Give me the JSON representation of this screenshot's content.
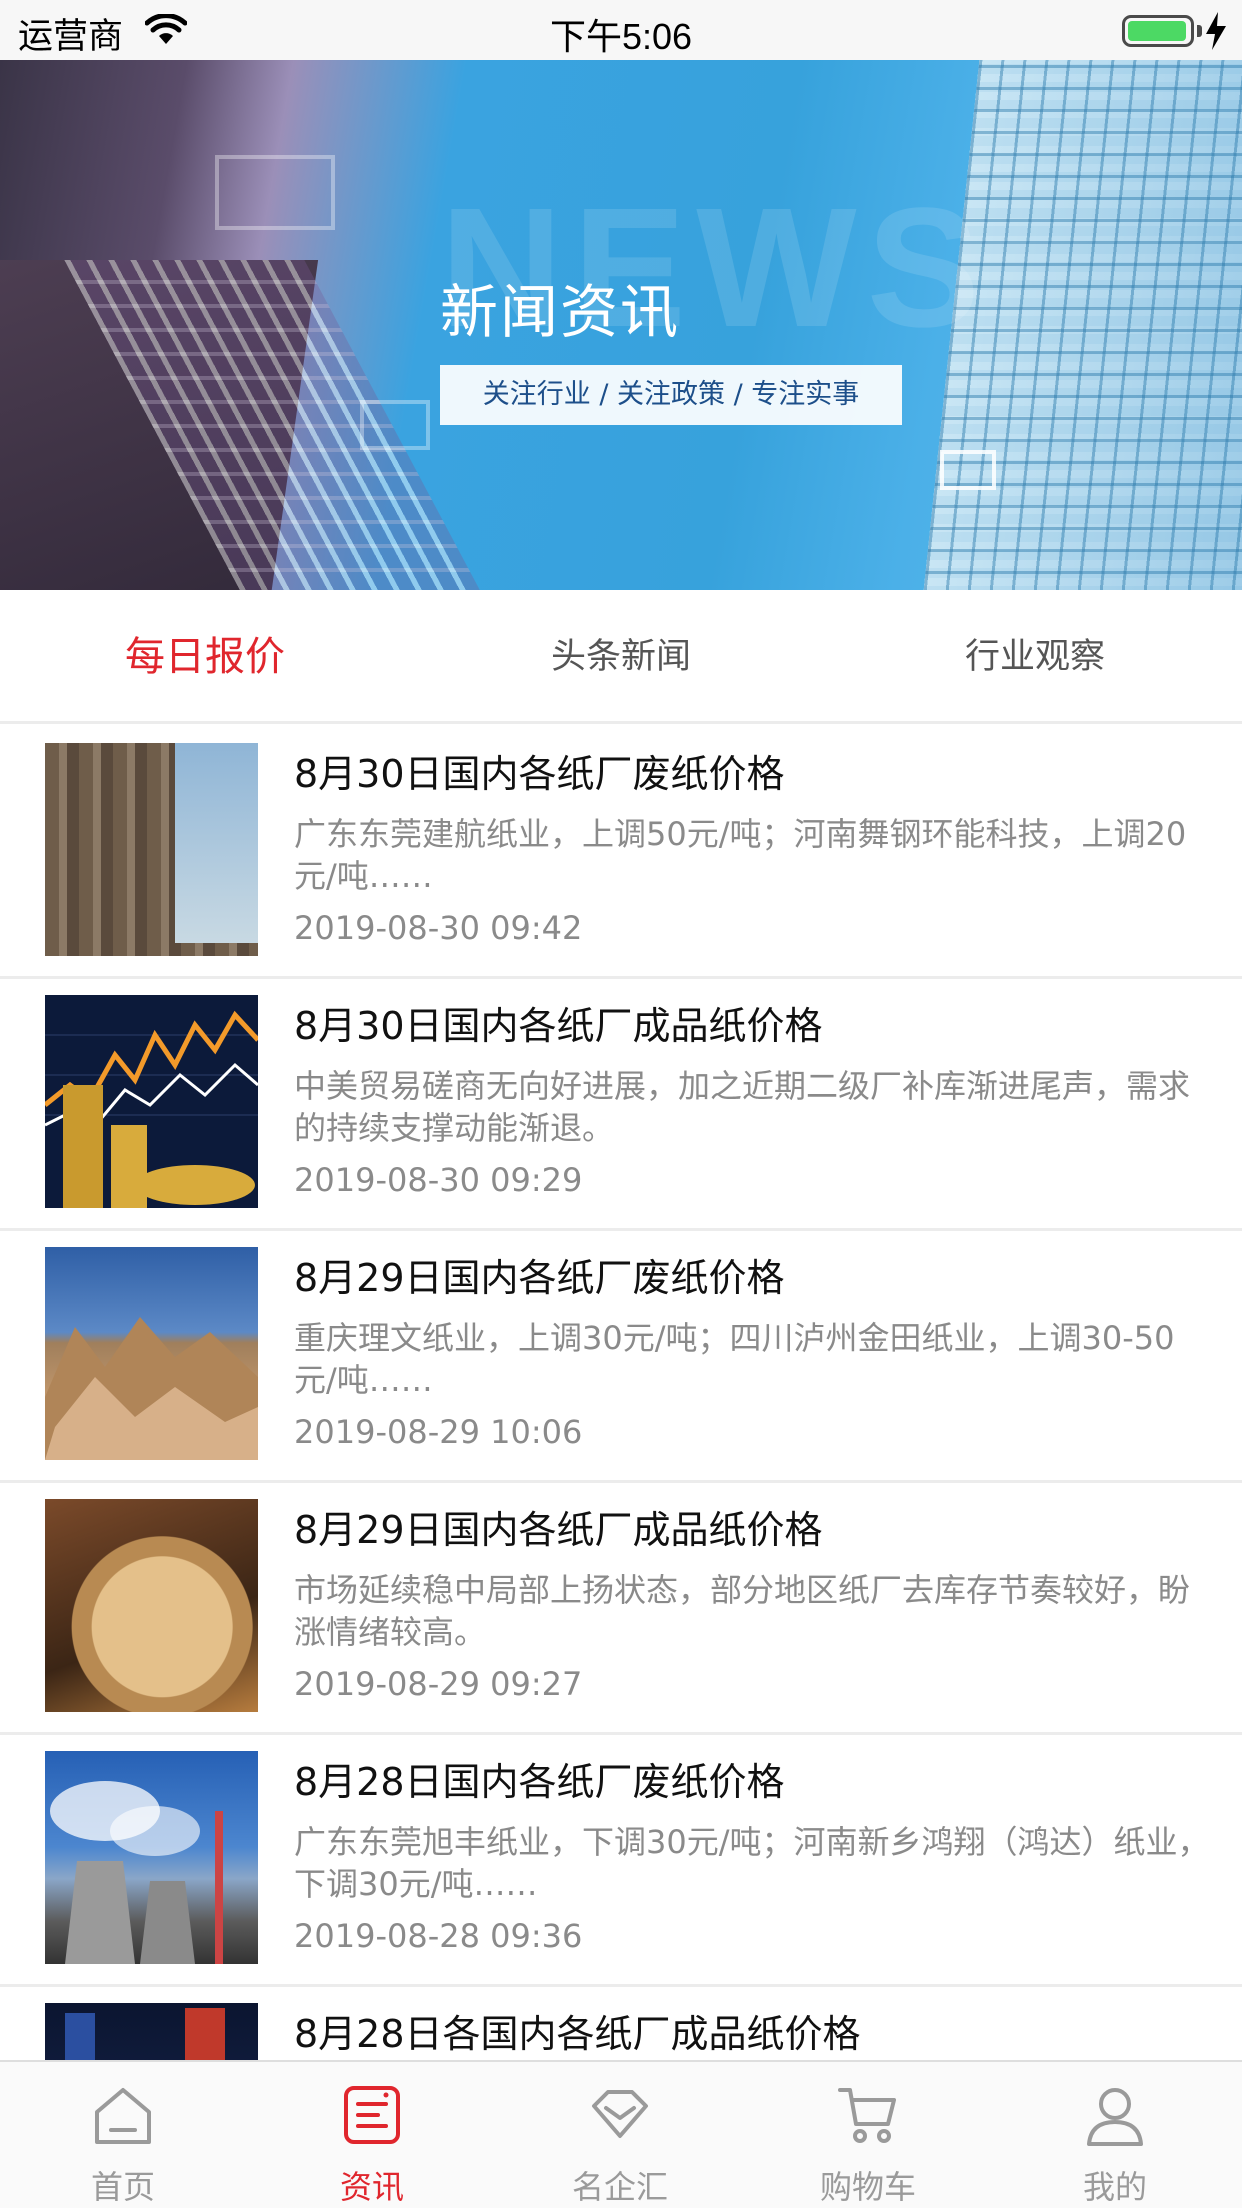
{
  "status_bar": {
    "carrier": "运营商",
    "time": "下午5:06"
  },
  "banner": {
    "title": "新闻资讯",
    "subtitle": "关注行业 / 关注政策 / 专注实事",
    "ghost_text": "NEWS"
  },
  "tabs": [
    {
      "label": "每日报价",
      "active": true
    },
    {
      "label": "头条新闻",
      "active": false
    },
    {
      "label": "行业观察",
      "active": false
    }
  ],
  "news": [
    {
      "title": "8月30日国内各纸厂废纸价格",
      "desc": "广东东莞建航纸业，上调50元/吨；河南舞钢环能科技，上调20元/吨……",
      "date": "2019-08-30 09:42",
      "image": "waste-paper-bales"
    },
    {
      "title": " 8月30日国内各纸厂成品纸价格",
      "desc": "中美贸易磋商无向好进展，加之近期二级厂补库渐进尾声，需求的持续支撑动能渐退。",
      "date": "2019-08-30 09:29",
      "image": "coins-stock-chart"
    },
    {
      "title": "8月29日国内各纸厂废纸价格",
      "desc": "重庆理文纸业，上调30元/吨；四川泸州金田纸业，上调30-50元/吨……",
      "date": "2019-08-29 10:06",
      "image": "cardboard-pile"
    },
    {
      "title": "8月29日国内各纸厂成品纸价格",
      "desc": "市场延续稳中局部上扬状态，部分地区纸厂去库存节奏较好，盼涨情绪较高。",
      "date": "2019-08-29 09:27",
      "image": "paper-rolls"
    },
    {
      "title": " 8月28日国内各纸厂废纸价格",
      "desc": "广东东莞旭丰纸业，下调30元/吨；河南新乡鸿翔（鸿达）纸业，下调30元/吨……",
      "date": "2019-08-28 09:36",
      "image": "cooling-towers"
    },
    {
      "title": " 8月28日各国内各纸厂成品纸价格",
      "desc": "",
      "date": "",
      "image": "night-city"
    }
  ],
  "tabbar": [
    {
      "label": "首页",
      "icon": "home-icon",
      "active": false
    },
    {
      "label": "资讯",
      "icon": "news-icon",
      "active": true
    },
    {
      "label": "名企汇",
      "icon": "diamond-icon",
      "active": false
    },
    {
      "label": "购物车",
      "icon": "cart-icon",
      "active": false
    },
    {
      "label": "我的",
      "icon": "user-icon",
      "active": false
    }
  ],
  "colors": {
    "accent": "#e0262d",
    "inactive": "#9a9a9a",
    "divider": "#ececec"
  }
}
